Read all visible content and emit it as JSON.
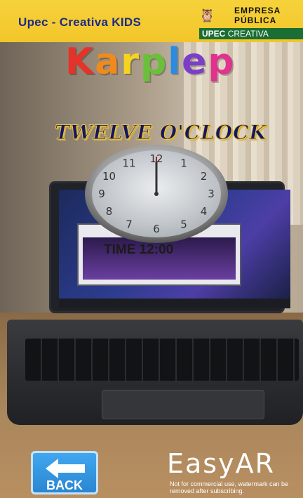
{
  "header": {
    "title": "Upec - Creativa KIDS",
    "brand": {
      "line1": "EMPRESA",
      "line2": "PÚBLICA",
      "line3a": "UPEC",
      "line3b": "CREATIVA"
    }
  },
  "ar": {
    "logo_letters": [
      "K",
      "a",
      "r",
      "p",
      "l",
      "e",
      "p"
    ],
    "clock_label": "TWELVE O'CLOCK",
    "time_text": "TIME 12:00",
    "clock_numbers": [
      "12",
      "1",
      "2",
      "3",
      "4",
      "5",
      "6",
      "7",
      "8",
      "9",
      "10",
      "11"
    ]
  },
  "controls": {
    "back_label": "BACK"
  },
  "watermark": {
    "brand": "EasyAR",
    "note": "Not for commercial use, watermark can be removed after subscribing."
  }
}
